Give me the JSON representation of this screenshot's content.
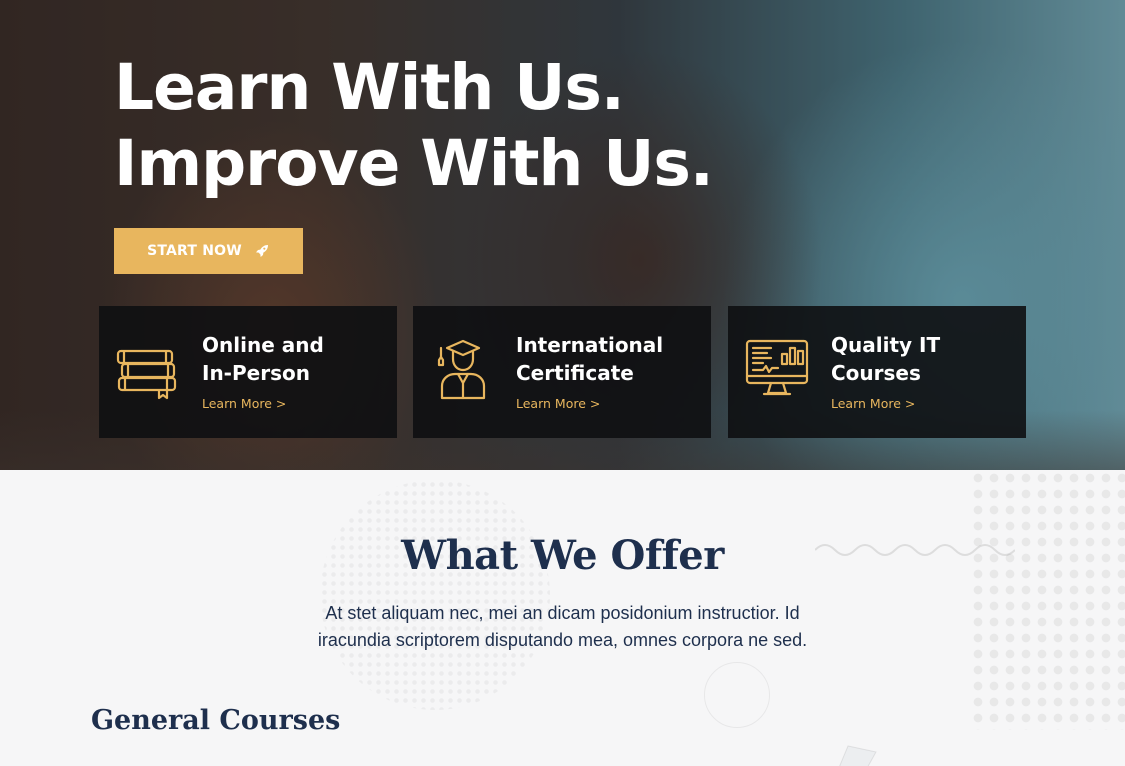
{
  "hero": {
    "title_line1": "Learn With Us.",
    "title_line2": "Improve With Us.",
    "cta_label": "START NOW",
    "cta_icon": "rocket-icon",
    "cards": [
      {
        "title_line1": "Online and",
        "title_line2": "In-Person",
        "link": "Learn More >",
        "icon": "books-icon"
      },
      {
        "title_line1": "International",
        "title_line2": "Certificate",
        "link": "Learn More >",
        "icon": "graduate-icon"
      },
      {
        "title_line1": "Quality IT",
        "title_line2": "Courses",
        "link": "Learn More >",
        "icon": "computer-monitor-icon"
      }
    ]
  },
  "offer": {
    "title": "What We Offer",
    "description": "At stet aliquam nec, mei an dicam posidonium instructior. Id iracundia scriptorem disputando mea, omnes corpora ne sed.",
    "section_title": "General Courses"
  },
  "colors": {
    "accent": "#e8b65e",
    "navy": "#1e2f4d",
    "card_bg": "#0e1012"
  }
}
